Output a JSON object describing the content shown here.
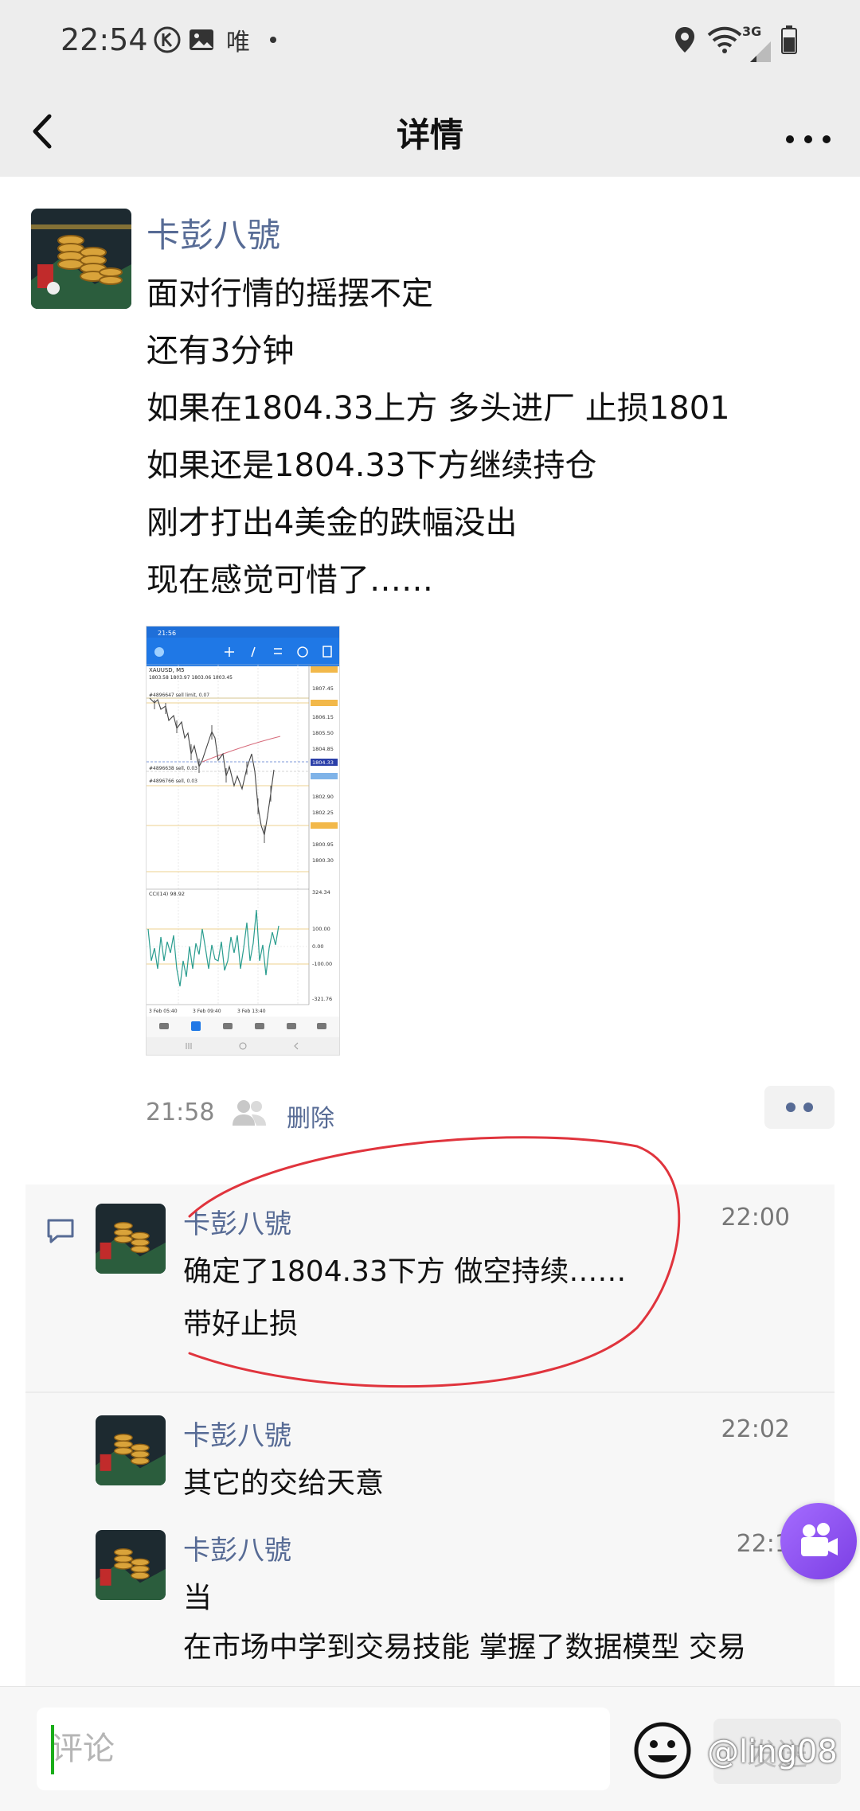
{
  "status_bar": {
    "time": "22:54",
    "icons": [
      "k-app-icon",
      "image-icon",
      "唯",
      "dot-icon",
      "location-icon",
      "wifi-icon",
      "3G",
      "signal-icon",
      "battery-icon"
    ],
    "network": "3G",
    "carrier_char": "唯"
  },
  "nav": {
    "title": "详情"
  },
  "post": {
    "author": "卡彭八號",
    "lines": [
      "面对行情的摇摆不定",
      "还有3分钟",
      "如果在1804.33上方 多头进厂 止损1801",
      "如果还是1804.33下方继续持仓",
      "刚才打出4美金的跌幅没出",
      "现在感觉可惜了……"
    ],
    "time": "21:58",
    "delete_label": "删除"
  },
  "thumbnail": {
    "time": "21:56",
    "symbol": "XAUUSD, M5",
    "ohlc": "1803.58 1803.97 1803.06 1803.45",
    "order1": "#4896647 sell limit, 0.07",
    "order2": "#4896638 sell, 0.03",
    "order3": "#4896766 sell, 0.03",
    "prices": [
      "1807.45",
      "1806.15",
      "1805.50",
      "1804.85",
      "1804.33",
      "1802.90",
      "1802.25",
      "1800.95",
      "1800.30"
    ],
    "indicator": "CCI(14) 98.92",
    "cci_ticks": [
      "324.34",
      "100.00",
      "0.00",
      "-100.00",
      "-321.76"
    ],
    "x_labels": [
      "3 Feb 05:40",
      "3 Feb 09:40",
      "3 Feb 13:40"
    ]
  },
  "comments": [
    {
      "name": "卡彭八號",
      "time": "22:00",
      "lines": [
        "确定了1804.33下方 做空持续……",
        "带好止损"
      ]
    },
    {
      "name": "卡彭八號",
      "time": "22:02",
      "lines": [
        "其它的交给天意"
      ]
    },
    {
      "name": "卡彭八號",
      "time": "22:1",
      "lines": [
        "当",
        "在市场中学到交易技能 掌握了数据模型 交易"
      ]
    }
  ],
  "input": {
    "placeholder": "评论"
  },
  "send_label": "发送",
  "watermark": "@ling08",
  "colors": {
    "link": "#576b95",
    "background": "#ededed",
    "annotation": "#e0343d",
    "float_button": "#8a4cf0"
  }
}
